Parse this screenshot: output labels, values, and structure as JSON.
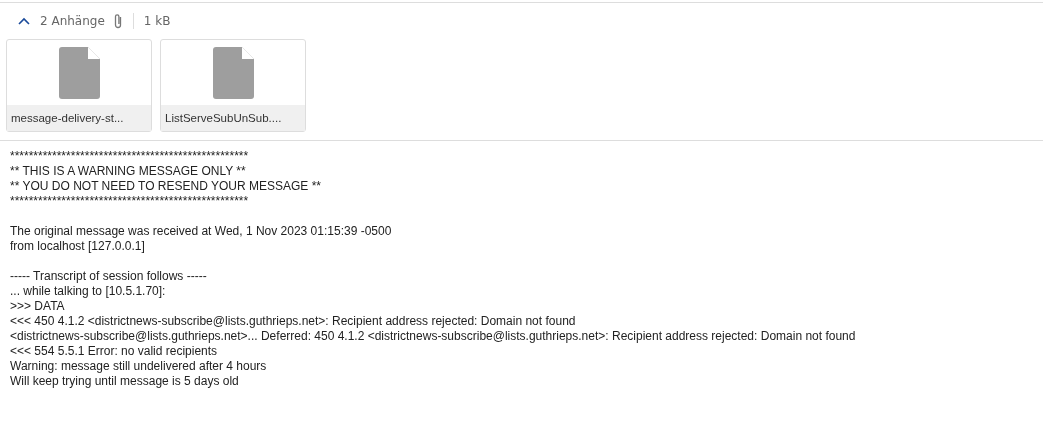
{
  "attachments": {
    "expanded": true,
    "count_label": "2 Anhänge",
    "size": "1 kB",
    "files": [
      {
        "name": "message-delivery-st..."
      },
      {
        "name": "ListServeSubUnSub...."
      }
    ]
  },
  "body": {
    "paragraphs": [
      [
        "***************************************************",
        "** THIS IS A WARNING MESSAGE ONLY **",
        "** YOU DO NOT NEED TO RESEND YOUR MESSAGE **",
        "***************************************************"
      ],
      [
        "The original message was received at Wed, 1 Nov 2023 01:15:39 -0500",
        "from localhost [127.0.0.1]"
      ],
      [
        "----- Transcript of session follows -----",
        "... while talking to [10.5.1.70]:",
        ">>> DATA",
        "<<< 450 4.1.2 <districtnews-subscribe@lists.guthrieps.net>: Recipient address rejected: Domain not found",
        "<districtnews-subscribe@lists.guthrieps.net>... Deferred: 450 4.1.2 <districtnews-subscribe@lists.guthrieps.net>: Recipient address rejected: Domain not found",
        "<<< 554 5.5.1 Error: no valid recipients",
        "Warning: message still undelivered after 4 hours",
        "Will keep trying until message is 5 days old"
      ]
    ]
  }
}
